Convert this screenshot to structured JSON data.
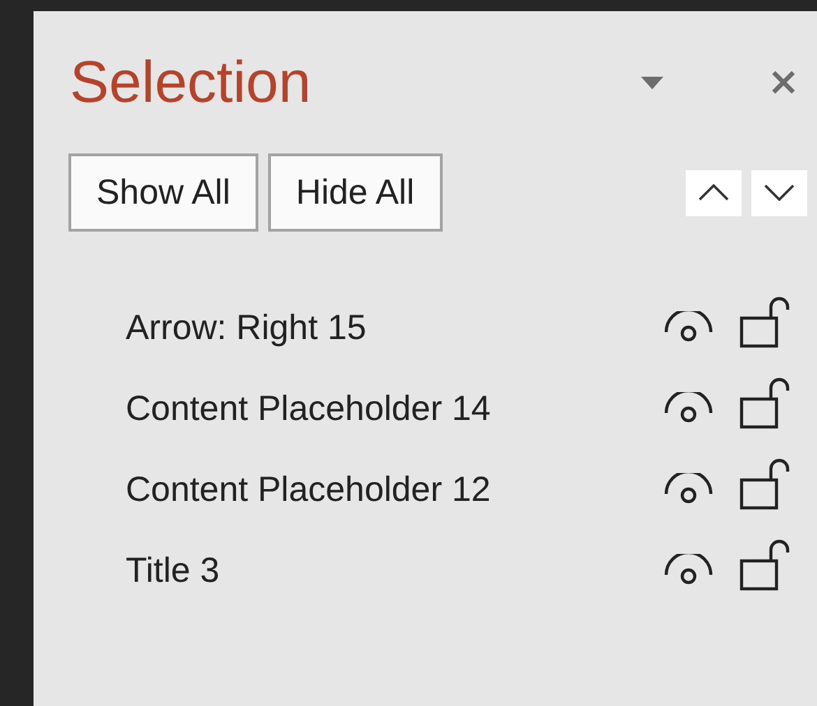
{
  "pane": {
    "title": "Selection"
  },
  "buttons": [
    "Show All",
    "Hide All"
  ],
  "items": [
    {
      "label": "Arrow: Right 15",
      "visible": true,
      "locked": false
    },
    {
      "label": "Content Placeholder 14",
      "visible": true,
      "locked": false
    },
    {
      "label": "Content Placeholder 12",
      "visible": true,
      "locked": false
    },
    {
      "label": "Title 3",
      "visible": true,
      "locked": false
    }
  ]
}
